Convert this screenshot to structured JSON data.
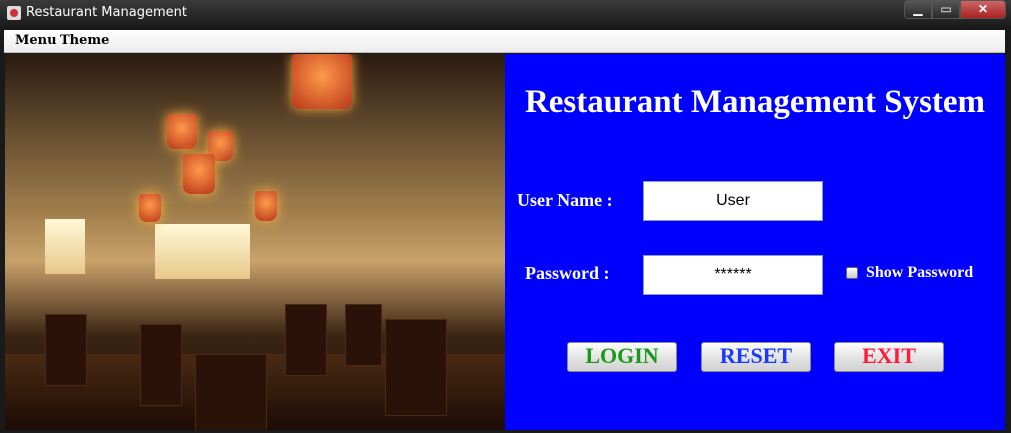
{
  "window": {
    "title": "Restaurant Management",
    "controls": {
      "minimize": "▁",
      "maximize": "▭",
      "close": "✕"
    }
  },
  "menubar": {
    "items": [
      {
        "label": "Menu"
      },
      {
        "label": "Theme"
      }
    ]
  },
  "panel": {
    "title": "Restaurant Management System",
    "background_color": "#0000ff"
  },
  "form": {
    "username_label": "User Name :",
    "username_value": "User",
    "password_label": "Password :",
    "password_value": "******",
    "show_password_label": "Show Password",
    "show_password_checked": false
  },
  "buttons": {
    "login": {
      "label": "LOGIN",
      "color": "#1a9a1a"
    },
    "reset": {
      "label": "RESET",
      "color": "#1a3aff"
    },
    "exit": {
      "label": "EXIT",
      "color": "#ff1a3a"
    }
  }
}
